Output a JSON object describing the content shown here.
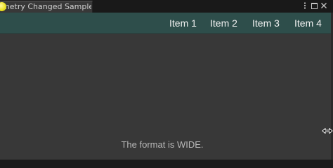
{
  "window": {
    "tab_title": "Geometry Changed Sample",
    "icons": [
      "unity-scene-icon",
      "kebab-menu-icon",
      "maximize-icon",
      "close-icon"
    ]
  },
  "nav": {
    "items": [
      "Item 1",
      "Item 2",
      "Item 3",
      "Item 4"
    ],
    "background_color": "#2e4e4b"
  },
  "content": {
    "status_text": "The format is WIDE.",
    "background_color": "#383838"
  },
  "cursor": {
    "icon": "horizontal-resize-cursor"
  }
}
